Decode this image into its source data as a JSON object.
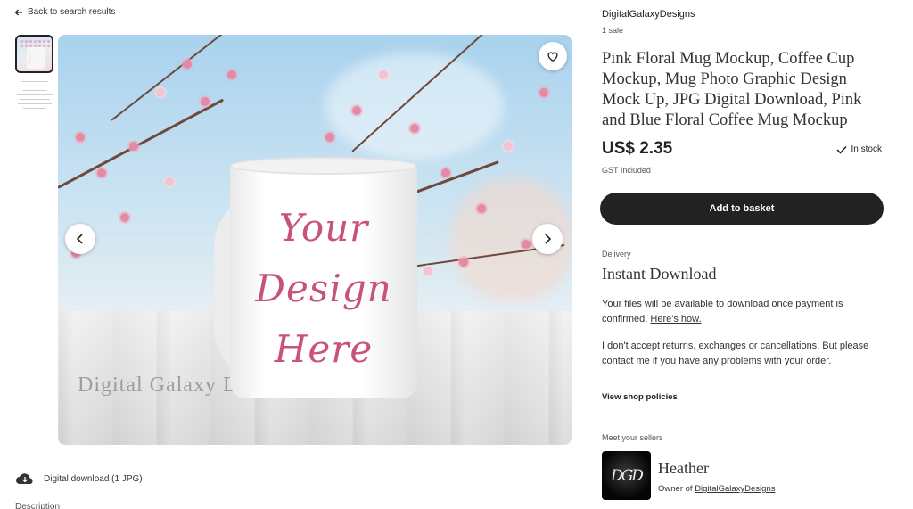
{
  "nav": {
    "back_label": "Back to search results"
  },
  "gallery": {
    "watermark": "Digital Galaxy Designs",
    "mug_text_1": "Your",
    "mug_text_2": "Design",
    "mug_text_3": "Here",
    "thumbnail_count": 2
  },
  "listing": {
    "shop_name": "DigitalGalaxyDesigns",
    "sales": "1 sale",
    "title": "Pink Floral Mug Mockup, Coffee Cup Mockup, Mug Photo Graphic Design Mock Up, JPG Digital Download, Pink and Blue Floral Coffee Mug Mockup",
    "price": "US$ 2.35",
    "stock": "In stock",
    "tax_note": "GST Included",
    "add_to_basket": "Add to basket"
  },
  "delivery": {
    "label": "Delivery",
    "value": "Instant Download",
    "files_text": "Your files will be available to download once payment is confirmed. ",
    "files_link": "Here's how.",
    "returns_text": "I don't accept returns, exchanges or cancellations. But please contact me if you have any problems with your order.",
    "policies_link": "View shop policies"
  },
  "seller": {
    "meet_label": "Meet your sellers",
    "logo_text": "DGD",
    "name": "Heather",
    "owner_prefix": "Owner of ",
    "owner_shop": "DigitalGalaxyDesigns"
  },
  "download": {
    "label": "Digital download (1 JPG)"
  },
  "description": {
    "heading": "Description"
  },
  "colors": {
    "accent_button": "#222222",
    "mug_text": "#c85278",
    "blossom": "#e58aa6",
    "sky": "#a9d2ee"
  },
  "icons": [
    "arrow-left-icon",
    "heart-icon",
    "chevron-left-icon",
    "chevron-right-icon",
    "checkmark-icon",
    "cloud-download-icon"
  ]
}
